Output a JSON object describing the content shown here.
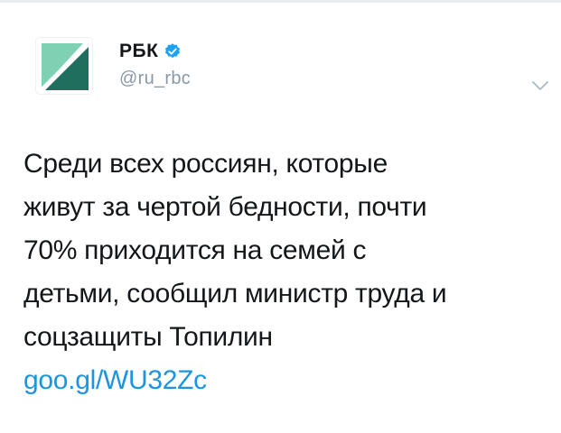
{
  "tweet": {
    "author": {
      "display_name": "РБК",
      "handle": "@ru_rbc",
      "verified": true,
      "avatar_icon": "rbc-logo-icon"
    },
    "text": "Среди всех россиян, которые\nживут за чертой бедности, почти\n70% приходится на семей с\nдетьми, сообщил министр труда и\nсоцзащиты Топилин",
    "link": "goo.gl/WU32Zc",
    "menu_icon": "chevron-down-icon"
  },
  "colors": {
    "link": "#1b95e0",
    "verified": "#1da1f2",
    "handle": "#8899a6",
    "logo_green": "#2a9d7a",
    "logo_dark": "#1f3b3a"
  }
}
